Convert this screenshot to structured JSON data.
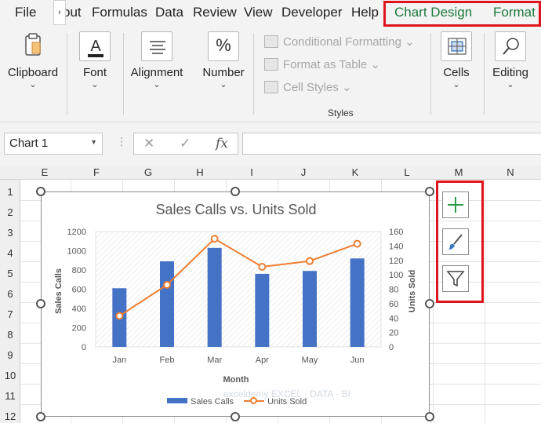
{
  "tabs": {
    "file": "File",
    "layout_partial": "out",
    "scroll_left": "‹",
    "formulas": "Formulas",
    "data": "Data",
    "review": "Review",
    "view": "View",
    "developer": "Developer",
    "help": "Help",
    "chart_design": "Chart Design",
    "format": "Format"
  },
  "ribbon": {
    "clipboard": "Clipboard",
    "font": "Font",
    "alignment": "Alignment",
    "number": "Number",
    "number_icon": "%",
    "conditional_formatting": "Conditional Formatting",
    "format_as_table": "Format as Table",
    "cell_styles": "Cell Styles",
    "styles_group": "Styles",
    "cells": "Cells",
    "editing": "Editing"
  },
  "formula_bar": {
    "name_box": "Chart 1",
    "fx": "fx",
    "cancel": "✕",
    "enter": "✓",
    "value": ""
  },
  "columns": [
    "E",
    "F",
    "G",
    "H",
    "I",
    "J",
    "K",
    "L",
    "M",
    "N"
  ],
  "rows": [
    "1",
    "2",
    "3",
    "4",
    "5",
    "6",
    "7",
    "8",
    "9",
    "10",
    "11",
    "12"
  ],
  "accent": {
    "bar": "#4472c4",
    "line": "#ed7d31",
    "green_tab": "#1e7a3c",
    "highlight": "#e0141e"
  },
  "chart_data": {
    "type": "bar",
    "title": "Sales Calls vs. Units Sold",
    "xlabel": "Month",
    "ylabel": "Sales Calls",
    "y2label": "Units Sold",
    "categories": [
      "Jan",
      "Feb",
      "Mar",
      "Apr",
      "May",
      "Jun"
    ],
    "ylim": [
      0,
      1200
    ],
    "y2lim": [
      0,
      160
    ],
    "yticks": [
      0,
      200,
      400,
      600,
      800,
      1000,
      1200
    ],
    "y2ticks": [
      0,
      20,
      40,
      60,
      80,
      100,
      120,
      140,
      160
    ],
    "series": [
      {
        "name": "Sales Calls",
        "type": "bar",
        "axis": "left",
        "values": [
          610,
          890,
          1030,
          760,
          790,
          920
        ]
      },
      {
        "name": "Units Sold",
        "type": "line",
        "axis": "right",
        "values": [
          43,
          86,
          150,
          111,
          119,
          143
        ]
      }
    ],
    "legend": "bottom",
    "watermark": "exceldemy EXCEL · DATA · BI"
  },
  "side_buttons": [
    "plus-icon",
    "brush-icon",
    "filter-icon"
  ]
}
